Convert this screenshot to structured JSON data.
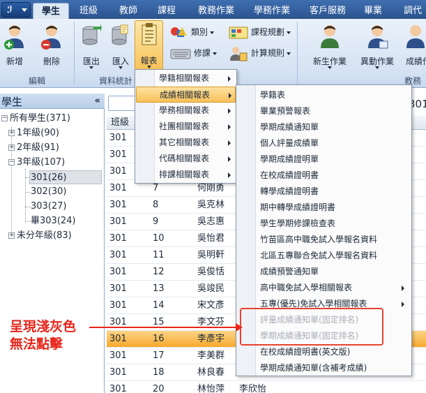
{
  "app": {
    "logo_text": "ℐ"
  },
  "tabs": [
    {
      "label": "學生",
      "active": true
    },
    {
      "label": "班級"
    },
    {
      "label": "教師"
    },
    {
      "label": "課程"
    },
    {
      "label": "教務作業"
    },
    {
      "label": "學務作業"
    },
    {
      "label": "客戶服務"
    },
    {
      "label": "畢業"
    },
    {
      "label": "調代"
    }
  ],
  "ribbon": {
    "groups": [
      {
        "label": "編輯"
      },
      {
        "label": "資料統計"
      },
      {
        "label": "教務"
      }
    ],
    "buttons": {
      "add": "新增",
      "delete": "刪除",
      "export": "匯出",
      "import": "匯入",
      "report": "報表",
      "category": "類別",
      "modify": "修課",
      "course_plan": "課程規劃",
      "score_rules": "計算規則",
      "new_student": "新生作業",
      "transfer": "異動作業",
      "grades": "成績作"
    }
  },
  "left_panel": {
    "title": "學生",
    "collapse_glyph": "«",
    "tree": [
      {
        "label": "所有學生(371)"
      },
      {
        "label": "1年級(90)"
      },
      {
        "label": "2年級(91)"
      },
      {
        "label": "3年級(107)"
      },
      {
        "label": "301(26)"
      },
      {
        "label": "302(30)"
      },
      {
        "label": "303(27)"
      },
      {
        "label": "畢303(24)"
      },
      {
        "label": "未分年級(83)"
      }
    ]
  },
  "grid": {
    "header_class": "班級",
    "rows": [
      {
        "cls": "301",
        "seat": "",
        "name": ""
      },
      {
        "cls": "301",
        "seat": "",
        "name": ""
      },
      {
        "cls": "301",
        "seat": "",
        "name": ""
      },
      {
        "cls": "301",
        "seat": "7",
        "name": "何剛勇"
      },
      {
        "cls": "301",
        "seat": "8",
        "name": "吳克林"
      },
      {
        "cls": "301",
        "seat": "9",
        "name": "吳志惠"
      },
      {
        "cls": "301",
        "seat": "10",
        "name": "吳怡君"
      },
      {
        "cls": "301",
        "seat": "11",
        "name": "吳明軒"
      },
      {
        "cls": "301",
        "seat": "12",
        "name": "吳俊恬"
      },
      {
        "cls": "301",
        "seat": "13",
        "name": "吳竣民"
      },
      {
        "cls": "301",
        "seat": "14",
        "name": "宋文彥"
      },
      {
        "cls": "301",
        "seat": "15",
        "name": "李文芬"
      },
      {
        "cls": "301",
        "seat": "16",
        "name": "李彥宇",
        "highlight": true
      },
      {
        "cls": "301",
        "seat": "17",
        "name": "李美群"
      },
      {
        "cls": "301",
        "seat": "18",
        "name": "林良春"
      },
      {
        "cls": "301",
        "seat": "20",
        "name": "林怡萍",
        "extra": "李欣怡"
      }
    ],
    "right_label": "301"
  },
  "menu1": [
    {
      "label": "學籍相關報表"
    },
    {
      "label": "成績相關報表",
      "hover": true
    },
    {
      "label": "學務相關報表"
    },
    {
      "label": "社團相關報表"
    },
    {
      "label": "其它相關報表"
    },
    {
      "label": "代碼相關報表"
    },
    {
      "label": "排課相關報表"
    }
  ],
  "menu2": [
    {
      "label": "學籍表"
    },
    {
      "label": "畢業預警報表"
    },
    {
      "label": "學期成績通知單"
    },
    {
      "label": "個人評量成績單"
    },
    {
      "label": "學期成績證明單"
    },
    {
      "label": "在校成績證明書"
    },
    {
      "label": "轉學成績證明書"
    },
    {
      "label": "期中轉學成績證明書"
    },
    {
      "label": "學生學期修課檢查表"
    },
    {
      "label": "竹苗區高中職免試入學報名資料"
    },
    {
      "label": "北區五專聯合免試入學報名資料"
    },
    {
      "label": "成績預警通知單"
    },
    {
      "label": "高中職免試入學相關報表",
      "submenu": true
    },
    {
      "label": "五專(優先)免試入學相關報表",
      "submenu": true
    },
    {
      "label": "評量成績通知單(固定排名)",
      "disabled": true
    },
    {
      "label": "學期成績通知單(固定排名)",
      "disabled": true
    },
    {
      "label": "在校成績證明書(英文版)"
    },
    {
      "label": "學期成績通知單(含補考成績)"
    }
  ],
  "annotation": {
    "line1": "呈現淺灰色",
    "line2": "無法點擊",
    "color": "#e8261b"
  }
}
